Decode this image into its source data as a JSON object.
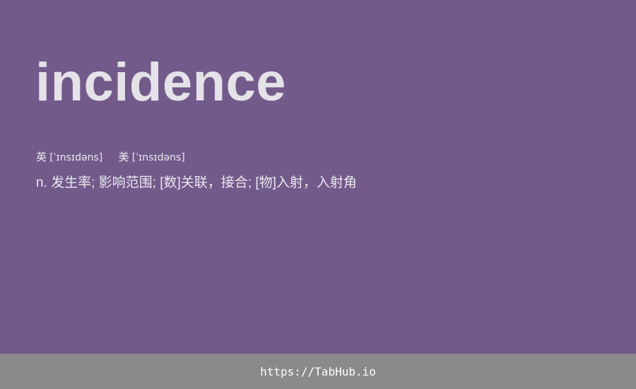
{
  "card": {
    "background": "#725a8a",
    "word": "incidence",
    "phonetics": {
      "uk_label": "英",
      "uk_ipa": "[ˈɪnsɪdəns]",
      "us_label": "美",
      "us_ipa": "[ˈɪnsɪdəns]"
    },
    "definition": "n. 发生率; 影响范围; [数]关联，接合; [物]入射，入射角"
  },
  "footer": {
    "background": "#8a8a8a",
    "url": "https://TabHub.io"
  }
}
